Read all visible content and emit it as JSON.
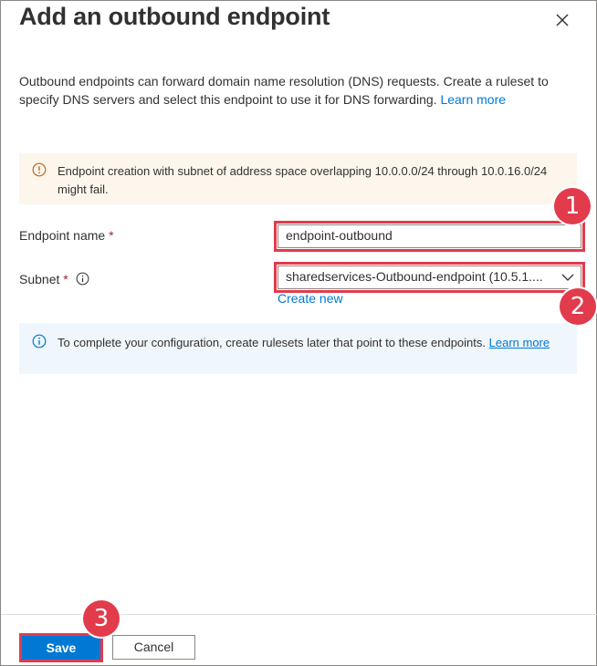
{
  "panel": {
    "title": "Add an outbound endpoint",
    "intro_text": "Outbound endpoints can forward domain name resolution (DNS) requests. Create a ruleset to specify DNS servers and select this endpoint to use it for DNS forwarding.",
    "intro_link": "Learn more"
  },
  "warning": {
    "text": "Endpoint creation with subnet of address space overlapping 10.0.0.0/24 through 10.0.16.0/24 might fail."
  },
  "form": {
    "endpoint_name_label": "Endpoint name",
    "endpoint_name_value": "endpoint-outbound",
    "subnet_label": "Subnet",
    "required_marker": "*",
    "subnet_value": "sharedservices-Outbound-endpoint (10.5.1....",
    "create_new": "Create new"
  },
  "info": {
    "text": "To complete your configuration, create rulesets later that point to these endpoints.",
    "link": "Learn more"
  },
  "footer": {
    "save_label": "Save",
    "cancel_label": "Cancel"
  },
  "callouts": {
    "one": "1",
    "two": "2",
    "three": "3"
  },
  "colors": {
    "accent": "#0078d4",
    "callout": "#e23b4c",
    "warning_bg": "#fdf6ec",
    "info_bg": "#eff6fc"
  },
  "icons": [
    "close-icon",
    "warning-icon",
    "info-icon",
    "chevron-down-icon"
  ]
}
